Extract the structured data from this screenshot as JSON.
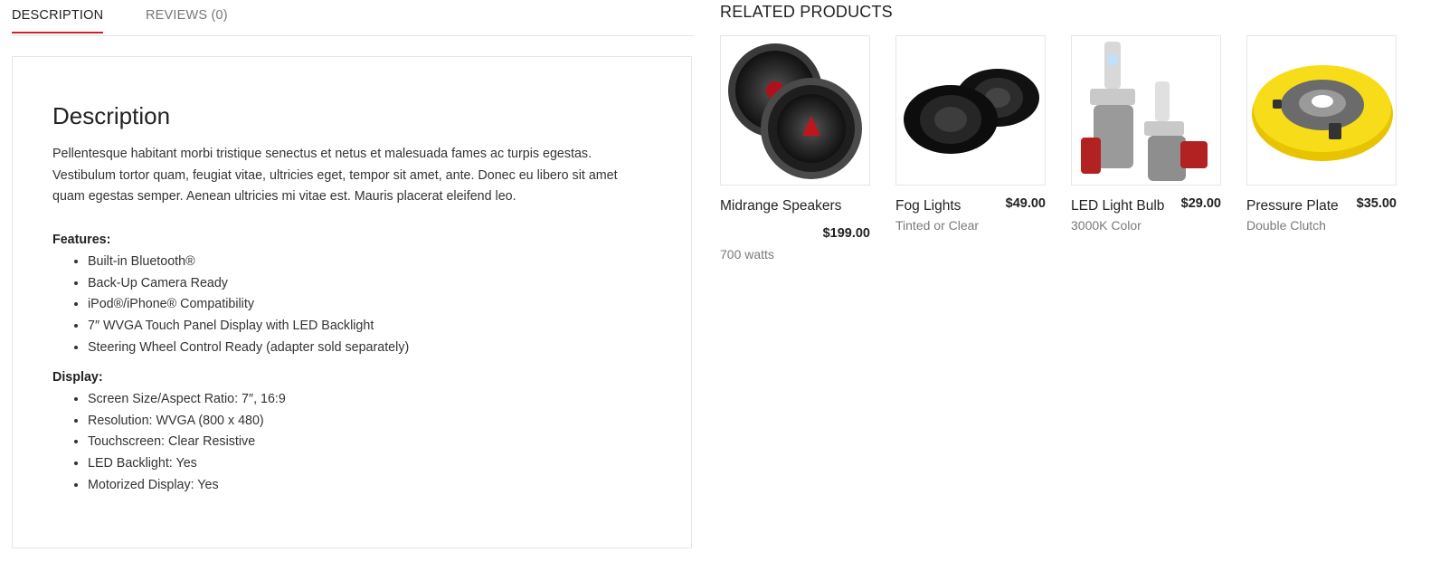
{
  "tabs": {
    "description": "Description",
    "reviews": "Reviews (0)"
  },
  "description": {
    "heading": "Description",
    "text": "Pellentesque habitant morbi tristique senectus et netus et malesuada fames ac turpis egestas. Vestibulum tortor quam, feugiat vitae, ultricies eget, tempor sit amet, ante. Donec eu libero sit amet quam egestas semper. Aenean ultricies mi vitae est. Mauris placerat eleifend leo.",
    "features_label": "Features:",
    "features": [
      "Built-in Bluetooth®",
      "Back-Up Camera Ready",
      "iPod®/iPhone® Compatibility",
      "7″ WVGA Touch Panel Display with LED Backlight",
      "Steering Wheel Control Ready (adapter sold separately)"
    ],
    "display_label": "Display:",
    "display": [
      "Screen Size/Aspect Ratio: 7″, 16:9",
      "Resolution: WVGA (800 x 480)",
      "Touchscreen: Clear Resistive",
      "LED Backlight: Yes",
      "Motorized Display: Yes"
    ]
  },
  "related": {
    "title": "Related Products",
    "products": [
      {
        "name": "Midrange Speakers",
        "price": "$199.00",
        "subtitle": "700 watts",
        "icon": "speaker-icon"
      },
      {
        "name": "Fog Lights",
        "price": "$49.00",
        "subtitle": "Tinted or Clear",
        "icon": "fog-light-icon"
      },
      {
        "name": "LED Light Bulb",
        "price": "$29.00",
        "subtitle": "3000K Color",
        "icon": "led-bulb-icon"
      },
      {
        "name": "Pressure Plate",
        "price": "$35.00",
        "subtitle": "Double Clutch",
        "icon": "pressure-plate-icon"
      }
    ]
  },
  "colors": {
    "accent": "#d3202a",
    "border": "#e6e6e6",
    "muted_text": "#7a7a7a"
  }
}
